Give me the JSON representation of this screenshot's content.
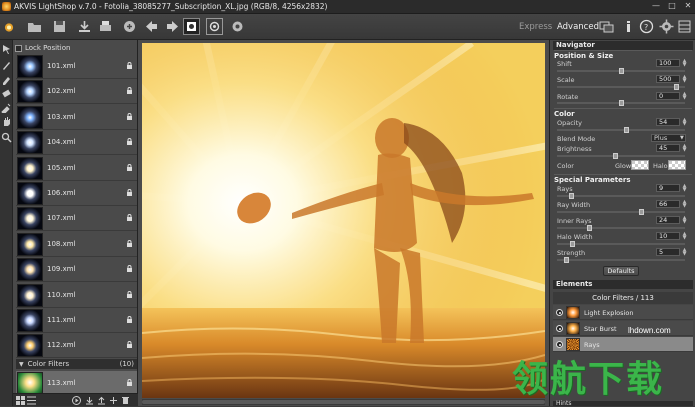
{
  "window": {
    "title": "AKVIS LightShop v.7.0 - Fotolia_38085277_Subscription_XL.jpg (RGB/8, 4256x2832)",
    "controls": [
      "—",
      "□",
      "✕"
    ]
  },
  "toolbar": {
    "mode_express": "Express",
    "mode_advanced": "Advanced",
    "icons": [
      "open-icon",
      "save-icon",
      "print-icon",
      "publish-icon",
      "back-icon",
      "forward-icon",
      "run-icon",
      "crop-icon",
      "preview-icon",
      "settings-icon",
      "info-icon",
      "help-icon",
      "preferences-icon",
      "layers-icon"
    ]
  },
  "presets": {
    "lock_label": "Lock Position",
    "items": [
      {
        "name": "101.xml",
        "glow": "#9cc8ff"
      },
      {
        "name": "102.xml",
        "glow": "#b6d4ff"
      },
      {
        "name": "103.xml",
        "glow": "#7fb4ff"
      },
      {
        "name": "104.xml",
        "glow": "#d2e4ff"
      },
      {
        "name": "105.xml",
        "glow": "#fff2c8"
      },
      {
        "name": "106.xml",
        "glow": "#ffffff"
      },
      {
        "name": "107.xml",
        "glow": "#fff6d8"
      },
      {
        "name": "108.xml",
        "glow": "#ffe9a8"
      },
      {
        "name": "109.xml",
        "glow": "#ffe3b0"
      },
      {
        "name": "110.xml",
        "glow": "#fff1d0"
      },
      {
        "name": "111.xml",
        "glow": "#c8d8ff"
      },
      {
        "name": "112.xml",
        "glow": "#ffcf70"
      }
    ],
    "category": {
      "name": "Color Filters",
      "count": "(10)"
    },
    "selected": {
      "name": "113.xml"
    }
  },
  "panel": {
    "navigator": "Navigator",
    "position_size": "Position & Size",
    "shift": {
      "label": "Shift",
      "value": "100",
      "level": 0.5
    },
    "scale": {
      "label": "Scale",
      "value": "500",
      "level": 0.95
    },
    "rotate": {
      "label": "Rotate",
      "value": "0",
      "level": 0.5
    },
    "color_head": "Color",
    "opacity": {
      "label": "Opacity",
      "value": "54",
      "level": 0.54
    },
    "blend_mode": {
      "label": "Blend Mode",
      "value": "Plus"
    },
    "brightness": {
      "label": "Brightness",
      "value": "45",
      "level": 0.45
    },
    "color_label": "Color",
    "glow_label": "Glow",
    "halo_label": "Halo",
    "special": "Special Parameters",
    "rays": {
      "label": "Rays",
      "value": "9",
      "level": 0.09
    },
    "ray_width": {
      "label": "Ray Width",
      "value": "66",
      "level": 0.66
    },
    "inner_rays": {
      "label": "Inner Rays",
      "value": "24",
      "level": 0.24
    },
    "halo_width": {
      "label": "Halo Width",
      "value": "10",
      "level": 0.1
    },
    "strength": {
      "label": "Strength",
      "value": "5",
      "level": 0.05
    },
    "defaults": "Defaults",
    "elements": "Elements",
    "elements_group": "Color Filters / 113",
    "element_items": [
      {
        "name": "Light Explosion"
      },
      {
        "name": "Star Burst"
      },
      {
        "name": "Rays"
      }
    ],
    "hints": "Hints"
  },
  "watermark": {
    "url": "lhdown.com",
    "cn": "领航下载"
  }
}
